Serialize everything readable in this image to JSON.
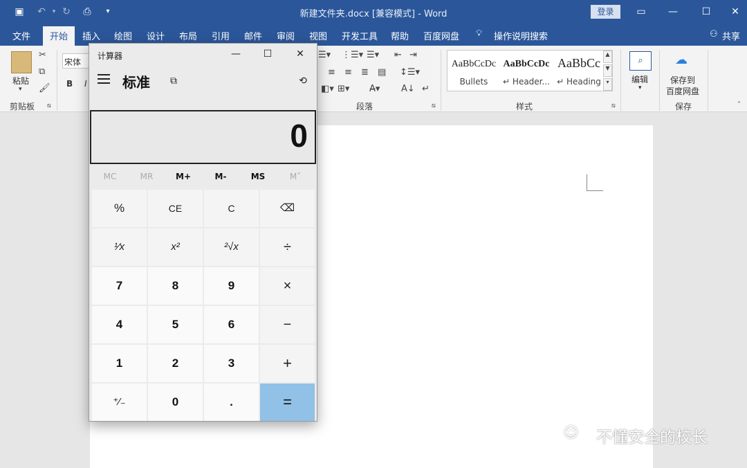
{
  "window": {
    "title": "新建文件夹.docx [兼容模式]  -  Word",
    "login_label": "登录",
    "qat": [
      "save-icon",
      "undo-icon",
      "redo-icon",
      "print-preview-icon",
      "customize-icon"
    ]
  },
  "tabs": [
    "文件",
    "开始",
    "插入",
    "绘图",
    "设计",
    "布局",
    "引用",
    "邮件",
    "审阅",
    "视图",
    "开发工具",
    "帮助",
    "百度网盘"
  ],
  "active_tab": "开始",
  "tell_me": "操作说明搜索",
  "share": "共享",
  "ribbon": {
    "paste_label": "粘贴",
    "clipboard_label": "剪贴板",
    "font_name": "宋体",
    "bold": "B",
    "italic": "I",
    "paragraph_label": "段落",
    "styles_label": "样式",
    "styles": [
      {
        "sample": "AaBbCcDc",
        "name": "Bullets"
      },
      {
        "sample": "AaBbCcDc",
        "name": "↵ Header..."
      },
      {
        "sample": "AaBbCc",
        "name": "↵ Heading"
      }
    ],
    "edit_label": "编辑",
    "save_to_line1": "保存到",
    "save_to_line2": "百度网盘",
    "save_group_label": "保存"
  },
  "calculator": {
    "title": "计算器",
    "mode": "标准",
    "display": "0",
    "memory": [
      "MC",
      "MR",
      "M+",
      "M-",
      "MS",
      "M˅"
    ],
    "keys": [
      [
        "%",
        "CE",
        "C",
        "⌫"
      ],
      [
        "¹⁄x",
        "x²",
        "²√x",
        "÷"
      ],
      [
        "7",
        "8",
        "9",
        "×"
      ],
      [
        "4",
        "5",
        "6",
        "−"
      ],
      [
        "1",
        "2",
        "3",
        "+"
      ],
      [
        "⁺⁄₋",
        "0",
        ".",
        "="
      ]
    ]
  },
  "watermark": "不懂安全的校长",
  "colors": {
    "word_blue": "#2b579a",
    "equals_blue": "#91c1e7"
  }
}
